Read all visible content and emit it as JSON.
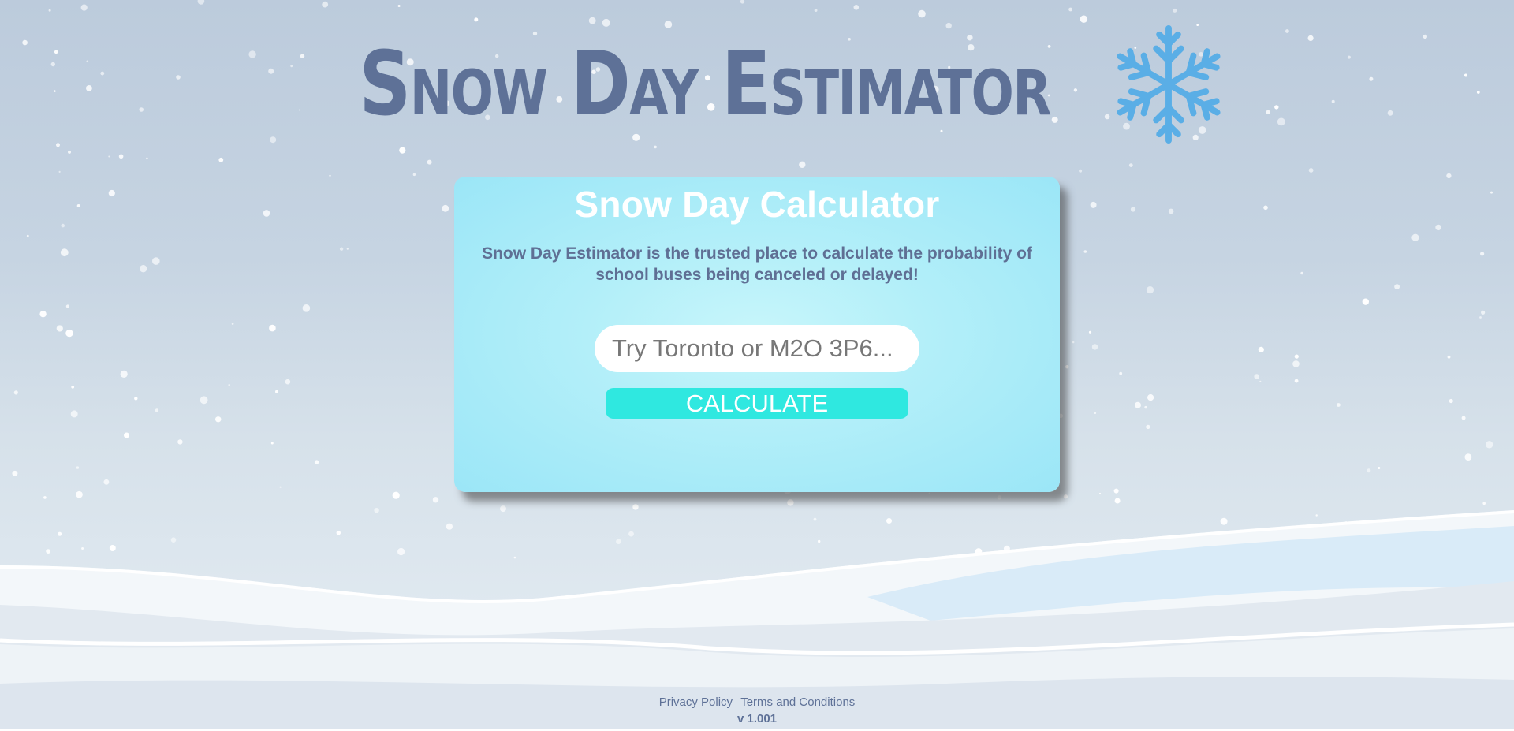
{
  "header": {
    "site_title": "Snow Day Estimator",
    "logo_icon": "snowflake-icon",
    "accent_color": "#5aaee6"
  },
  "calculator": {
    "title": "Snow Day Calculator",
    "description": "Snow Day Estimator is the trusted place to calculate the probability of school buses being canceled or delayed!",
    "search_placeholder": "Try Toronto or M2O 3P6...",
    "search_value": "",
    "calculate_label": "CALCULATE",
    "button_color": "#2fe8e0"
  },
  "footer": {
    "privacy_label": "Privacy Policy",
    "terms_label": "Terms and Conditions",
    "version": "v 1.001"
  }
}
